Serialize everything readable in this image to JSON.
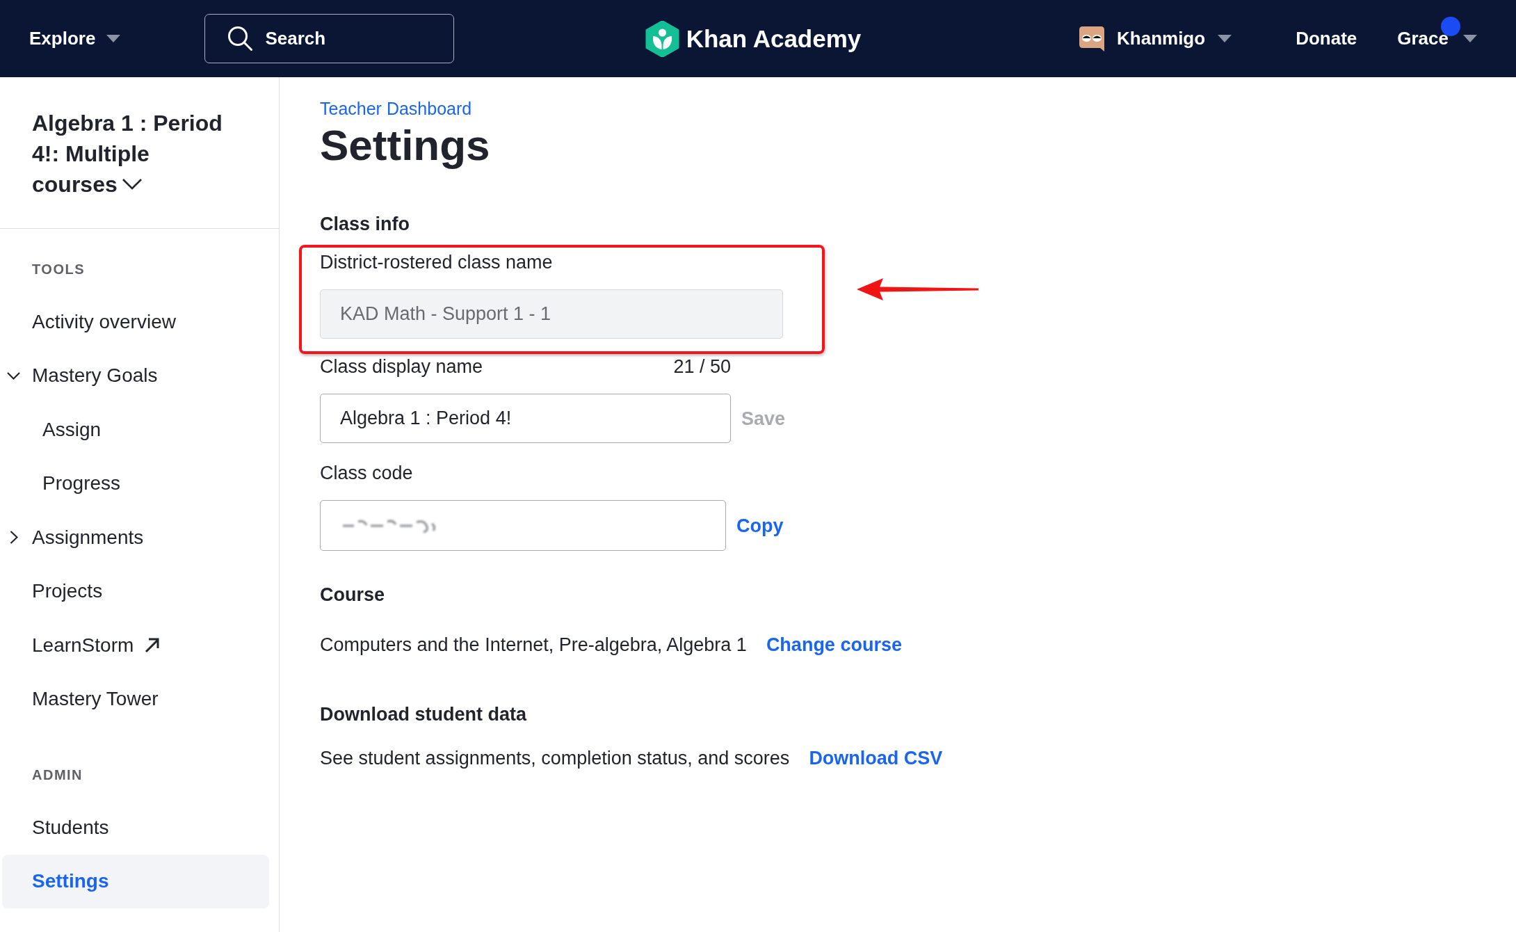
{
  "top_bar": {
    "explore": {
      "label": "Explore"
    },
    "search": {
      "placeholder": "Search"
    },
    "logo": {
      "text": "Khan Academy"
    },
    "khanmigo": {
      "label": "Khanmigo"
    },
    "donate": {
      "label": "Donate"
    },
    "user": {
      "name": "Grace",
      "notification": true
    }
  },
  "sidebar": {
    "class_title": "Algebra 1 : Period 4!: Multiple courses",
    "sections": [
      {
        "heading": "TOOLS",
        "items": [
          {
            "label": "Activity overview",
            "selected": false
          },
          {
            "label": "Mastery Goals",
            "selected": false,
            "expanded": true,
            "children": [
              {
                "label": "Assign",
                "selected": false
              },
              {
                "label": "Progress",
                "selected": false
              }
            ]
          },
          {
            "label": "Assignments",
            "selected": false,
            "expanded": false
          },
          {
            "label": "Projects",
            "selected": false
          },
          {
            "label": "LearnStorm",
            "selected": false,
            "external": true
          },
          {
            "label": "Mastery Tower",
            "selected": false
          }
        ]
      },
      {
        "heading": "ADMIN",
        "items": [
          {
            "label": "Students",
            "selected": false
          },
          {
            "label": "Settings",
            "selected": true
          }
        ]
      }
    ]
  },
  "page": {
    "breadcrumb": "Teacher Dashboard",
    "title": "Settings",
    "class_info": {
      "heading": "Class info",
      "district_name": {
        "label": "District-rostered class name",
        "value": "KAD Math - Support 1 - 1",
        "disabled": true,
        "highlighted": true
      },
      "display_name": {
        "label": "Class display name",
        "counter": "21 / 50",
        "value": "Algebra 1 : Period 4!",
        "action": "Save",
        "action_disabled": true
      },
      "class_code": {
        "label": "Class code",
        "redacted": true,
        "action": "Copy"
      }
    },
    "course": {
      "heading": "Course",
      "text": "Computers and the Internet, Pre-algebra, Algebra 1",
      "action": "Change course"
    },
    "download": {
      "heading": "Download student data",
      "text": "See student assignments, completion status, and scores",
      "action": "Download CSV"
    }
  }
}
